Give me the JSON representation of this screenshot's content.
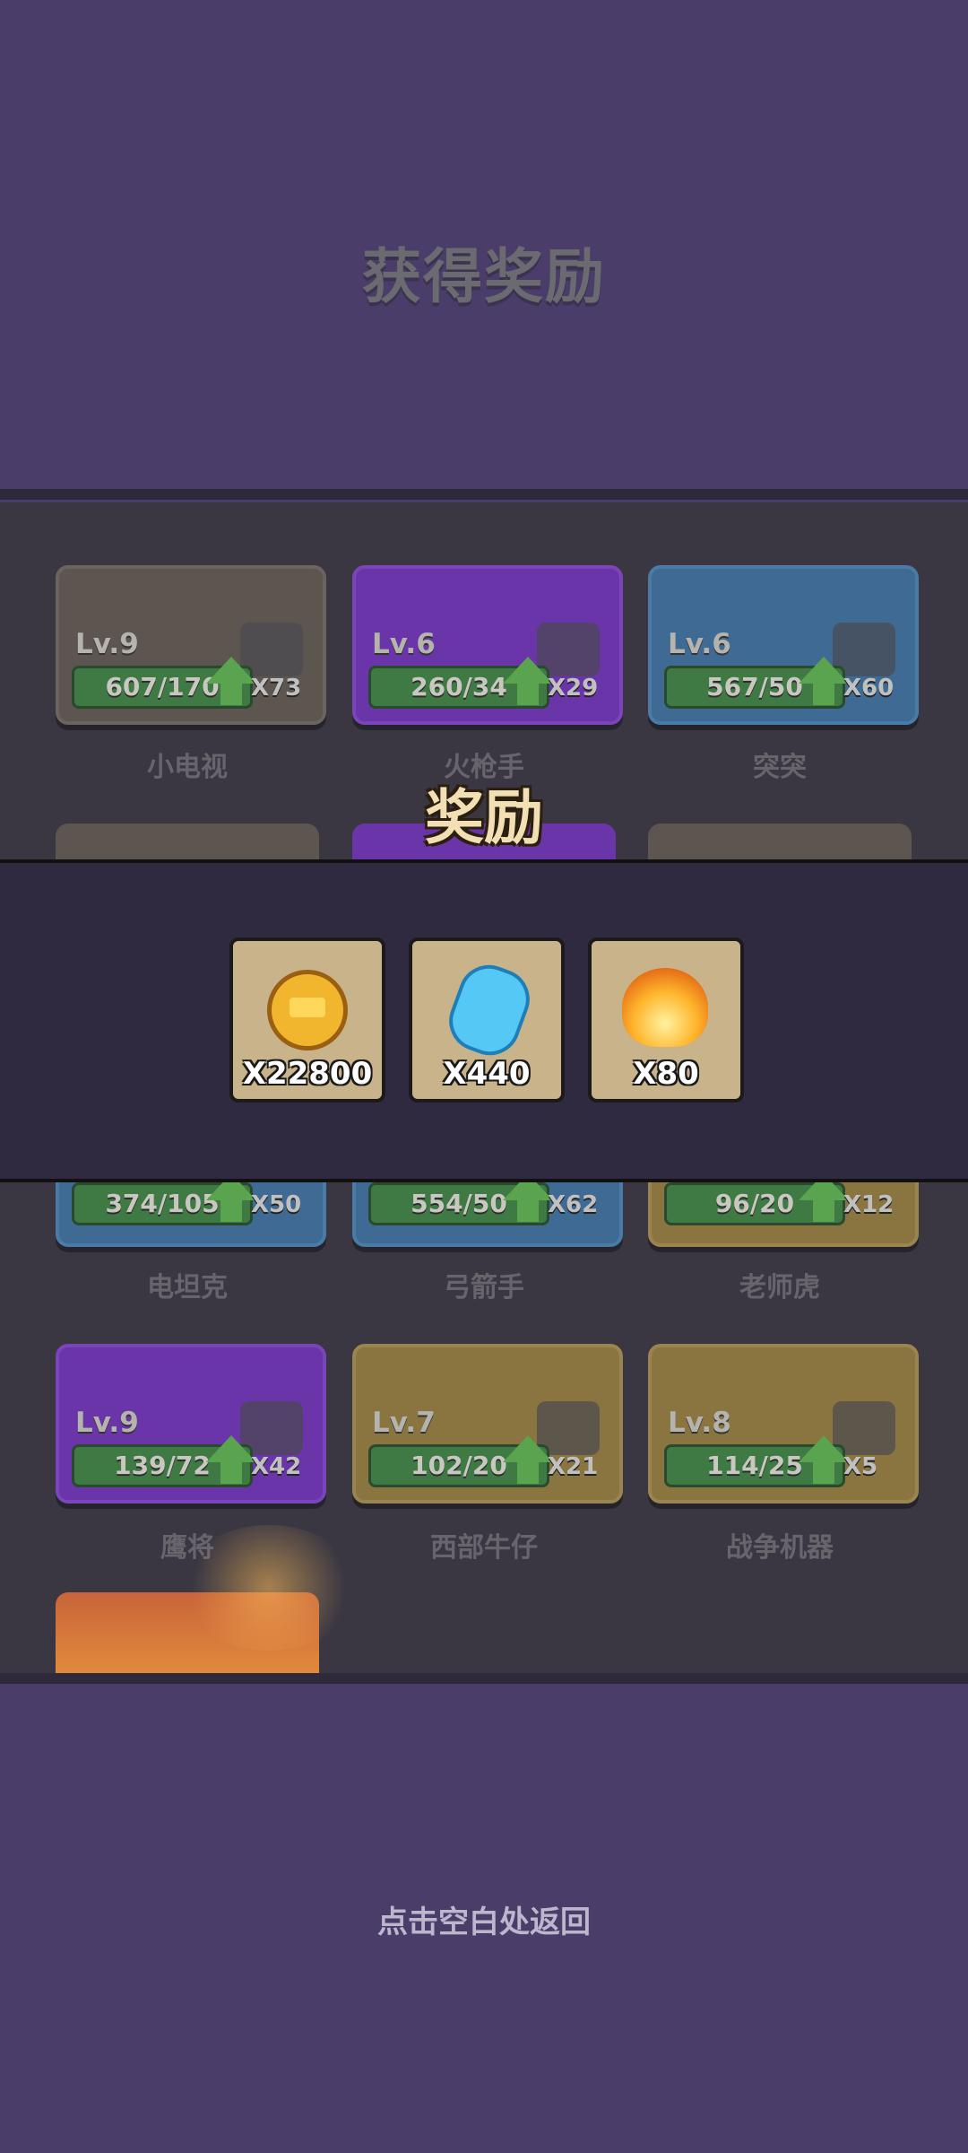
{
  "screen_title": "获得奖励",
  "reward_popup": {
    "title": "奖励",
    "items": [
      {
        "icon": "gold-crown-coin-icon",
        "count": "X22800"
      },
      {
        "icon": "blue-gem-icon",
        "count": "X440"
      },
      {
        "icon": "flame-icon",
        "count": "X80"
      }
    ]
  },
  "units_row1": [
    {
      "level": "Lv.9",
      "progress": "607/170",
      "count": "X73",
      "name": "小电视",
      "rarity": "gray"
    },
    {
      "level": "Lv.6",
      "progress": "260/34",
      "count": "X29",
      "name": "火枪手",
      "rarity": "purple"
    },
    {
      "level": "Lv.6",
      "progress": "567/50",
      "count": "X60",
      "name": "突突",
      "rarity": "blue"
    }
  ],
  "units_row3": [
    {
      "progress": "374/105",
      "count": "X50",
      "name": "电坦克",
      "rarity": "blue"
    },
    {
      "progress": "554/50",
      "count": "X62",
      "name": "弓箭手",
      "rarity": "blue"
    },
    {
      "progress": "96/20",
      "count": "X12",
      "name": "老师虎",
      "rarity": "gold"
    }
  ],
  "units_row4": [
    {
      "level": "Lv.9",
      "progress": "139/72",
      "count": "X42",
      "name": "鹰将",
      "rarity": "purple"
    },
    {
      "level": "Lv.7",
      "progress": "102/20",
      "count": "X21",
      "name": "西部牛仔",
      "rarity": "gold"
    },
    {
      "level": "Lv.8",
      "progress": "114/25",
      "count": "X5",
      "name": "战争机器",
      "rarity": "gold"
    }
  ],
  "footer_hint": "点击空白处返回"
}
